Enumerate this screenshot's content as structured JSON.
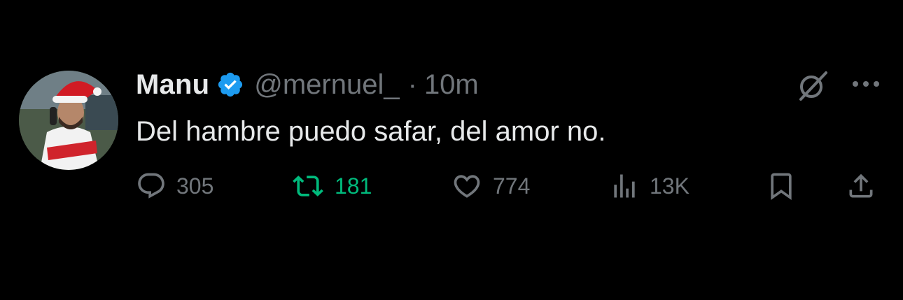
{
  "tweet": {
    "author_name": "Manu",
    "handle": "@mernuel_",
    "separator": "·",
    "time": "10m",
    "text": "Del hambre puedo safar, del amor no."
  },
  "stats": {
    "replies": "305",
    "retweets": "181",
    "likes": "774",
    "views": "13K"
  },
  "icons": {
    "verified": "verified-badge-icon",
    "grok": "grok-icon",
    "more": "more-options-icon",
    "reply": "reply-bubble-icon",
    "retweet": "retweet-icon",
    "like": "heart-icon",
    "views": "analytics-bars-icon",
    "bookmark": "bookmark-icon",
    "share": "share-upload-icon"
  },
  "colors": {
    "background": "#000000",
    "primary_text": "#e7e9ea",
    "secondary_text": "#71767b",
    "verified_blue": "#1d9bf0",
    "retweet_green": "#00ba7c"
  }
}
